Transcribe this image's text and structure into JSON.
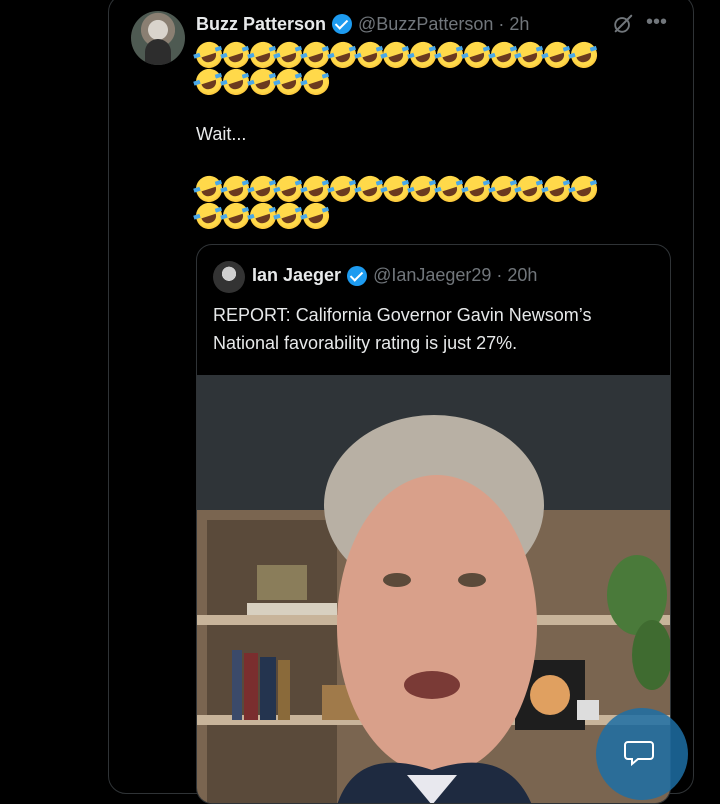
{
  "tweet": {
    "author_name": "Buzz Patterson",
    "author_handle": "@BuzzPatterson · 2h",
    "emoji_rows_1": [
      15,
      5
    ],
    "text": "Wait...",
    "emoji_rows_2": [
      15,
      5
    ]
  },
  "quoted_tweet": {
    "author_name": "Ian Jaeger",
    "author_handle": "@IanJaeger29 · 20h",
    "text_line_1": "REPORT: California Governor Gavin Newsom’s",
    "text_line_2": "National favorability rating is just 27%."
  },
  "icons": {
    "verified": "verified-badge-icon",
    "grok": "grok-icon",
    "more": "more-icon",
    "grok_chat": "grok-chat-icon"
  },
  "colors": {
    "background": "#000000",
    "text": "#e7e9ea",
    "secondary": "#71767b",
    "accent": "#1d9bf0",
    "border": "#2f3336"
  }
}
